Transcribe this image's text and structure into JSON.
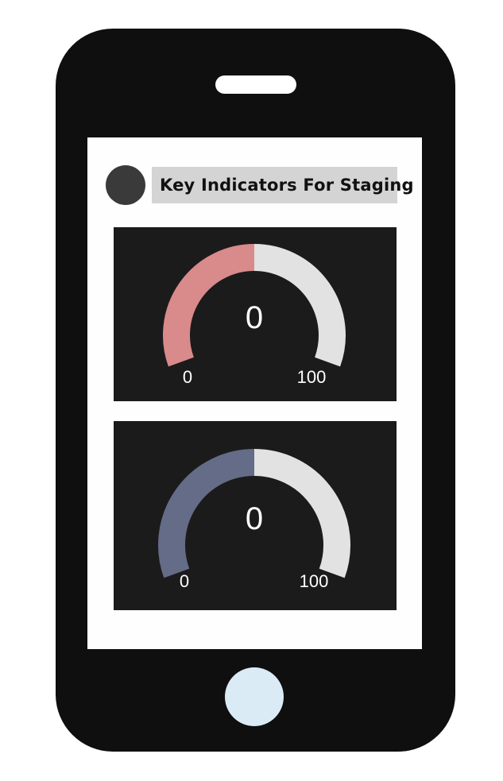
{
  "header": {
    "title": "Key Indicators For Staging"
  },
  "gauges": [
    {
      "value": 0,
      "value_text": "0",
      "min_label": "0",
      "max_label": "100",
      "accent_color": "#d98a8a",
      "track_color": "#e2e2e2"
    },
    {
      "value": 0,
      "value_text": "0",
      "min_label": "0",
      "max_label": "100",
      "accent_color": "#646c87",
      "track_color": "#e2e2e2"
    }
  ],
  "colors": {
    "phone_body": "#0f0f0f",
    "screen": "#fefefe",
    "card_background": "#1b1b1b",
    "title_background": "#d4d4d4",
    "home_button": "#dbebf6"
  }
}
